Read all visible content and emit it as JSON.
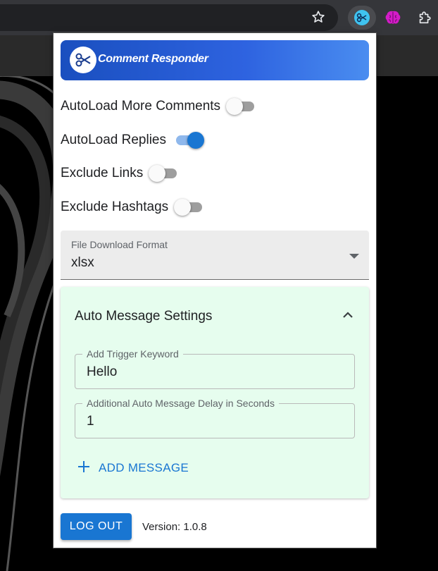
{
  "header": {
    "title": "Comment Responder"
  },
  "toggles": [
    {
      "label": "AutoLoad More Comments",
      "on": false
    },
    {
      "label": "AutoLoad Replies",
      "on": true
    },
    {
      "label": "Exclude Links",
      "on": false
    },
    {
      "label": "Exclude Hashtags",
      "on": false
    }
  ],
  "file_format": {
    "label": "File Download Format",
    "value": "xlsx"
  },
  "auto_message": {
    "title": "Auto Message Settings",
    "trigger": {
      "label": "Add Trigger Keyword",
      "value": "Hello"
    },
    "delay": {
      "label": "Additional Auto Message Delay in Seconds",
      "value": "1"
    },
    "add_label": "ADD MESSAGE"
  },
  "footer": {
    "logout_label": "LOG OUT",
    "version": "Version: 1.0.8"
  },
  "colors": {
    "primary": "#1976d2",
    "header_gradient_start": "#1a4fbf",
    "header_gradient_end": "#4a8df0",
    "accordion_bg": "#e6fdee"
  },
  "icons": {
    "extension_active": "scissors-icon",
    "extension_other": "brain-icon",
    "extensions": "puzzle-icon",
    "bookmark": "star-icon"
  }
}
